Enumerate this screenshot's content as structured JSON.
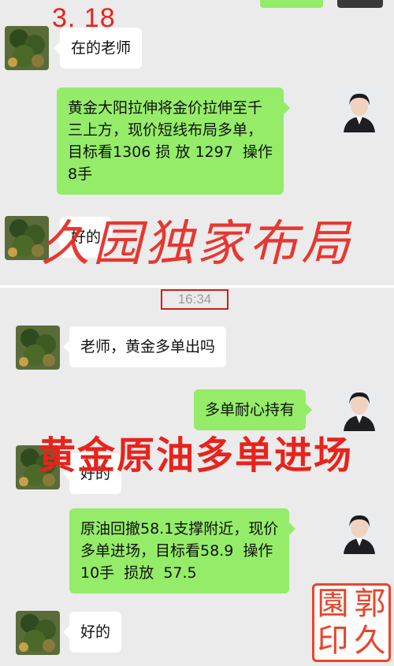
{
  "date_annotation": "3. 18",
  "time_label": "16:34",
  "overlays": {
    "top": "久园独家布局",
    "middle": "黄金原油多单进场"
  },
  "seal": {
    "chars": [
      "郭",
      "園",
      "久",
      "印"
    ]
  },
  "colors": {
    "background": "#ebebeb",
    "bubble_outgoing": "#95ec69",
    "bubble_incoming": "#ffffff",
    "annotation_red": "#e8231c",
    "seal_red": "#e8452c"
  },
  "messages": [
    {
      "side": "in",
      "text": "在的老师"
    },
    {
      "side": "out",
      "text": "黄金大阳拉伸将金价拉伸至千\n三上方，现价短线布局多单，\n目标看1306 损 放 1297  操作\n8手"
    },
    {
      "side": "in",
      "text": "好的"
    },
    {
      "side": "in",
      "text": "老师，黄金多单出吗"
    },
    {
      "side": "out",
      "text": "多单耐心持有"
    },
    {
      "side": "in",
      "text": "好的"
    },
    {
      "side": "out",
      "text": "原油回撤58.1支撑附近，现价\n多单进场，目标看58.9  操作\n10手  损放  57.5"
    },
    {
      "side": "in",
      "text": "好的"
    }
  ]
}
